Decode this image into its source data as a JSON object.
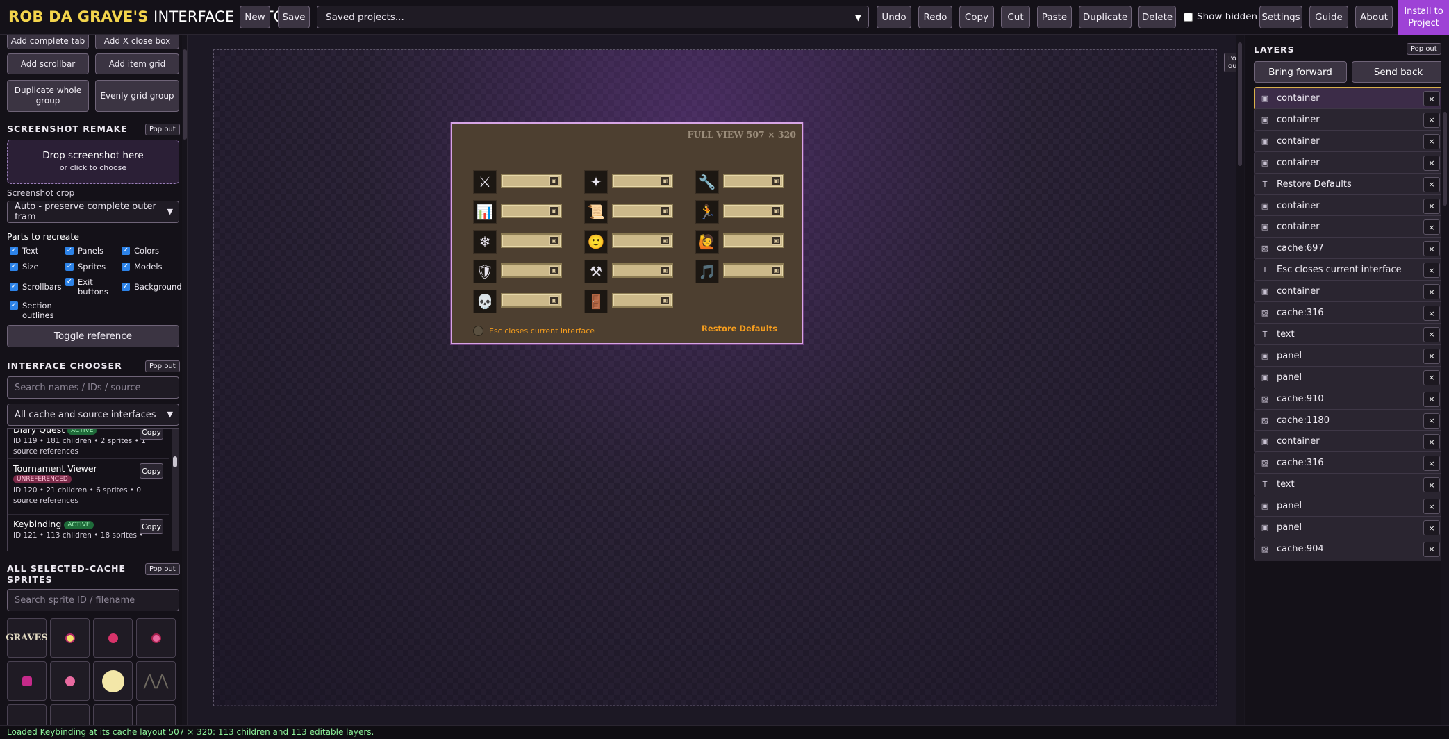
{
  "brand": {
    "bold": "ROB DA GRAVE'S",
    "light": "INTERFACE EDITOR"
  },
  "toolbar": {
    "new": "New",
    "save": "Save",
    "saved_projects": "Saved projects...",
    "undo": "Undo",
    "redo": "Redo",
    "copy": "Copy",
    "cut": "Cut",
    "paste": "Paste",
    "duplicate": "Duplicate",
    "delete": "Delete",
    "show_hidden": "Show hidden",
    "settings": "Settings",
    "guide": "Guide",
    "about": "About",
    "install": "Install to Project"
  },
  "left": {
    "buttons": {
      "add_complete_tab": "Add complete tab",
      "add_x_close_box": "Add X close box",
      "add_scrollbar": "Add scrollbar",
      "add_item_grid": "Add item grid",
      "duplicate_whole_group": "Duplicate whole group",
      "evenly_grid_group": "Evenly grid group"
    },
    "screenshot": {
      "title": "SCREENSHOT REMAKE",
      "popout": "Pop out",
      "drop_main": "Drop screenshot here",
      "drop_sub": "or click to choose",
      "crop_label": "Screenshot crop",
      "crop_value": "Auto - preserve complete outer fram",
      "parts_label": "Parts to recreate",
      "parts": [
        "Text",
        "Panels",
        "Colors",
        "Size",
        "Sprites",
        "Models",
        "Scrollbars",
        "Exit buttons",
        "Backgrounds",
        "Section outlines"
      ],
      "toggle_reference": "Toggle reference"
    },
    "chooser": {
      "title": "INTERFACE CHOOSER",
      "popout": "Pop out",
      "search_placeholder": "Search names / IDs / source",
      "filter_value": "All cache and source interfaces",
      "items": [
        {
          "name": "Diary Quest",
          "badge": "ACTIVE",
          "meta": "ID 119 • 181 children • 2 sprites • 1 source references",
          "copy": "Copy"
        },
        {
          "name": "Tournament Viewer",
          "badge": "UNREFERENCED",
          "meta": "ID 120 • 21 children • 6 sprites • 0 source references",
          "copy": "Copy"
        },
        {
          "name": "Keybinding",
          "badge": "ACTIVE",
          "meta": "ID 121 • 113 children • 18 sprites •",
          "copy": "Copy"
        }
      ]
    },
    "sprites": {
      "title": "ALL SELECTED-CACHE SPRITES",
      "popout": "Pop out",
      "search_placeholder": "Search sprite ID / filename",
      "logo_text": "GRAVES"
    }
  },
  "canvas": {
    "popout": "Pop out",
    "panel_title": "FULL VIEW 507 × 320",
    "esc_text": "Esc closes current interface",
    "restore_text": "Restore Defaults",
    "icons": [
      "⚔",
      "✦",
      "🔧",
      "📊",
      "📜",
      "🏃",
      "❄",
      "🙂",
      "🙋",
      "🛡",
      "⚒",
      "🎵",
      "💀",
      "🚪"
    ]
  },
  "layers": {
    "title": "LAYERS",
    "popout": "Pop out",
    "bring_forward": "Bring forward",
    "send_back": "Send back",
    "items": [
      {
        "type": "panel",
        "name": "container"
      },
      {
        "type": "panel",
        "name": "container"
      },
      {
        "type": "panel",
        "name": "container"
      },
      {
        "type": "panel",
        "name": "container"
      },
      {
        "type": "text",
        "name": "Restore Defaults"
      },
      {
        "type": "panel",
        "name": "container"
      },
      {
        "type": "panel",
        "name": "container"
      },
      {
        "type": "sprite",
        "name": "cache:697"
      },
      {
        "type": "text",
        "name": "Esc closes current interface"
      },
      {
        "type": "panel",
        "name": "container"
      },
      {
        "type": "sprite",
        "name": "cache:316"
      },
      {
        "type": "text",
        "name": "text"
      },
      {
        "type": "panel",
        "name": "panel"
      },
      {
        "type": "panel",
        "name": "panel"
      },
      {
        "type": "sprite",
        "name": "cache:910"
      },
      {
        "type": "sprite",
        "name": "cache:1180"
      },
      {
        "type": "panel",
        "name": "container"
      },
      {
        "type": "sprite",
        "name": "cache:316"
      },
      {
        "type": "text",
        "name": "text"
      },
      {
        "type": "panel",
        "name": "panel"
      },
      {
        "type": "panel",
        "name": "panel"
      },
      {
        "type": "sprite",
        "name": "cache:904"
      }
    ],
    "remove_label": "×"
  },
  "status": "Loaded Keybinding at its cache layout 507 × 320: 113 children and 113 editable layers.",
  "colors": {
    "brand_yellow": "#f3d44c",
    "install_purple": "#9e42d6",
    "rs_orange": "#f39c1e",
    "status_green": "#8ef29a"
  }
}
